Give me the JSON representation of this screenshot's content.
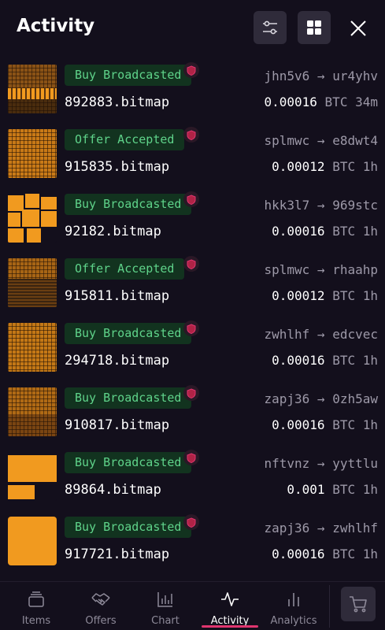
{
  "header": {
    "title": "Activity"
  },
  "activity": [
    {
      "status": "Buy Broadcasted",
      "name": "892883.bitmap",
      "from": "jhn5v6",
      "to": "ur4yhv",
      "amount": "0.00016",
      "currency": "BTC",
      "time": "34m"
    },
    {
      "status": "Offer Accepted",
      "name": "915835.bitmap",
      "from": "splmwc",
      "to": "e8dwt4",
      "amount": "0.00012",
      "currency": "BTC",
      "time": "1h"
    },
    {
      "status": "Buy Broadcasted",
      "name": "92182.bitmap",
      "from": "hkk3l7",
      "to": "969stc",
      "amount": "0.00016",
      "currency": "BTC",
      "time": "1h"
    },
    {
      "status": "Offer Accepted",
      "name": "915811.bitmap",
      "from": "splmwc",
      "to": "rhaahp",
      "amount": "0.00012",
      "currency": "BTC",
      "time": "1h"
    },
    {
      "status": "Buy Broadcasted",
      "name": "294718.bitmap",
      "from": "zwhlhf",
      "to": "edcvec",
      "amount": "0.00016",
      "currency": "BTC",
      "time": "1h"
    },
    {
      "status": "Buy Broadcasted",
      "name": "910817.bitmap",
      "from": "zapj36",
      "to": "0zh5aw",
      "amount": "0.00016",
      "currency": "BTC",
      "time": "1h"
    },
    {
      "status": "Buy Broadcasted",
      "name": "89864.bitmap",
      "from": "nftvnz",
      "to": "yyttlu",
      "amount": "0.001",
      "currency": "BTC",
      "time": "1h"
    },
    {
      "status": "Buy Broadcasted",
      "name": "917721.bitmap",
      "from": "zapj36",
      "to": "zwhlhf",
      "amount": "0.00016",
      "currency": "BTC",
      "time": "1h"
    }
  ],
  "arrow": "→",
  "nav": {
    "items": [
      {
        "label": "Items",
        "icon": "stack-icon"
      },
      {
        "label": "Offers",
        "icon": "handshake-icon"
      },
      {
        "label": "Chart",
        "icon": "bar-chart-icon"
      },
      {
        "label": "Activity",
        "icon": "activity-icon"
      },
      {
        "label": "Analytics",
        "icon": "analytics-icon"
      }
    ],
    "active": "Activity",
    "cart_icon": "cart-icon"
  },
  "colors": {
    "background": "#130f1c",
    "badge_bg": "#12331f",
    "badge_text": "#5fd38a",
    "accent": "#e0356f",
    "bitmap_orange": "#f19a1f"
  }
}
